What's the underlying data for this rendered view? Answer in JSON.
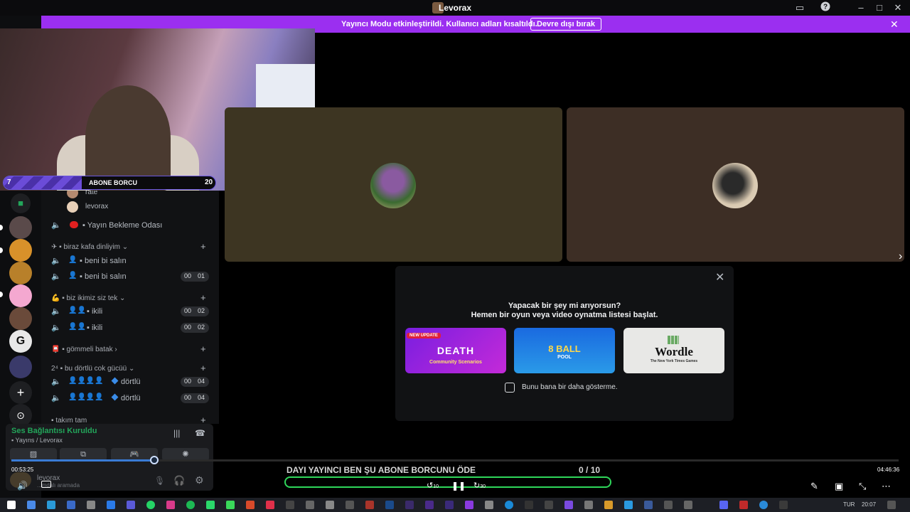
{
  "window": {
    "title": "Levorax",
    "controls": [
      "cast-icon",
      "help-icon",
      "minimize-icon",
      "maximize-icon",
      "close-icon"
    ]
  },
  "banner": {
    "message": "Yayıncı Modu etkinleştirildi. Kullanıcı adları kısaltıldı.",
    "button": "Devre dışı bırak",
    "bg": "#9b2ff0"
  },
  "webcam_hud": {
    "left": "7",
    "center": "ABONE BORCU",
    "right": "20"
  },
  "channels": {
    "voice_users": [
      {
        "name": "rate"
      },
      {
        "name": "levorax"
      }
    ],
    "waiting_room": "▪ Yayın Bekleme Odası",
    "categories": [
      {
        "label": "✈ ▪ biraz kafa dinliyim ⌄",
        "rows": [
          {
            "label": "▪ beni bi salın",
            "count": null
          },
          {
            "label": "▪ beni bi salın",
            "count": [
              "00",
              "01"
            ]
          }
        ]
      },
      {
        "label": "💪 ▪ biz ikimiz siz tek ⌄",
        "rows": [
          {
            "label": "▪ ikili",
            "count": [
              "00",
              "02"
            ]
          },
          {
            "label": "▪ ikili",
            "count": [
              "00",
              "02"
            ]
          }
        ]
      },
      {
        "label": "📮 ▪ gömmeli batak ›",
        "rows": []
      },
      {
        "label": "2⁴ ▪ bu dörtlü cok gücüü ⌄",
        "rows": [
          {
            "label": "dörtlü",
            "count": [
              "00",
              "04"
            ]
          },
          {
            "label": "dörtlü",
            "count": [
              "00",
              "04"
            ]
          }
        ]
      },
      {
        "label": "▪ takım tam",
        "rows": []
      }
    ]
  },
  "voice_panel": {
    "status": "Ses Bağlantısı Kuruldu",
    "channel": "▪ Yayıns / Levorax",
    "status_color": "#23a55a"
  },
  "user": {
    "name": "levorax",
    "status": "...mdalı aramada"
  },
  "modal": {
    "line1": "Yapacak bir şey mi arıyorsun?",
    "line2": "Hemen bir oyun veya video oynatma listesi başlat.",
    "cards": [
      {
        "title": "DEATH",
        "sub": "Community Scenarios",
        "badge": "NEW UPDATE"
      },
      {
        "title": "8 BALL",
        "sub": "POOL"
      },
      {
        "title": "Wordle",
        "sub": "The New York Times Games"
      }
    ],
    "checkbox_label": "Bunu bana bir daha gösterme."
  },
  "media": {
    "elapsed": "00:53:25",
    "total": "04:46:36",
    "progress": 0.162,
    "ticker": "DAYI YAYINCI BEN ŞU ABONE BORCUNU ÖDE",
    "goal_current": "0",
    "goal_total": "/ 10",
    "skip_back": "10",
    "skip_fwd": "30"
  },
  "taskbar": {
    "lang": "TUR",
    "time": "20:07"
  }
}
